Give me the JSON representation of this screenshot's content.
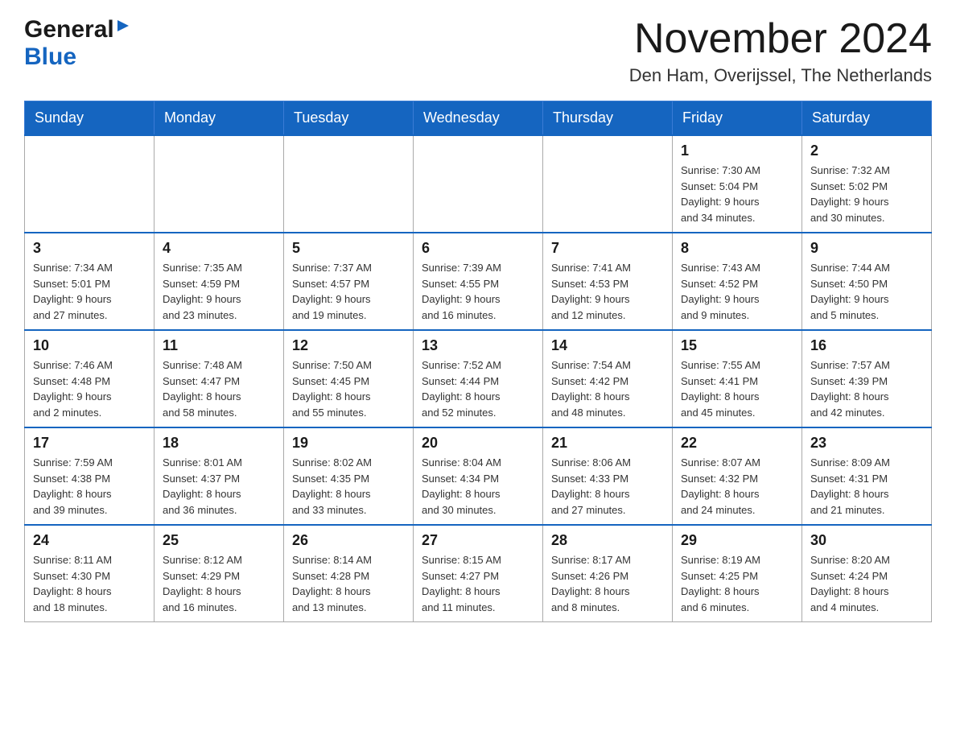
{
  "header": {
    "logo_general": "General",
    "logo_blue": "Blue",
    "title": "November 2024",
    "subtitle": "Den Ham, Overijssel, The Netherlands"
  },
  "days_of_week": [
    "Sunday",
    "Monday",
    "Tuesday",
    "Wednesday",
    "Thursday",
    "Friday",
    "Saturday"
  ],
  "weeks": [
    [
      {
        "day": "",
        "info": ""
      },
      {
        "day": "",
        "info": ""
      },
      {
        "day": "",
        "info": ""
      },
      {
        "day": "",
        "info": ""
      },
      {
        "day": "",
        "info": ""
      },
      {
        "day": "1",
        "info": "Sunrise: 7:30 AM\nSunset: 5:04 PM\nDaylight: 9 hours\nand 34 minutes."
      },
      {
        "day": "2",
        "info": "Sunrise: 7:32 AM\nSunset: 5:02 PM\nDaylight: 9 hours\nand 30 minutes."
      }
    ],
    [
      {
        "day": "3",
        "info": "Sunrise: 7:34 AM\nSunset: 5:01 PM\nDaylight: 9 hours\nand 27 minutes."
      },
      {
        "day": "4",
        "info": "Sunrise: 7:35 AM\nSunset: 4:59 PM\nDaylight: 9 hours\nand 23 minutes."
      },
      {
        "day": "5",
        "info": "Sunrise: 7:37 AM\nSunset: 4:57 PM\nDaylight: 9 hours\nand 19 minutes."
      },
      {
        "day": "6",
        "info": "Sunrise: 7:39 AM\nSunset: 4:55 PM\nDaylight: 9 hours\nand 16 minutes."
      },
      {
        "day": "7",
        "info": "Sunrise: 7:41 AM\nSunset: 4:53 PM\nDaylight: 9 hours\nand 12 minutes."
      },
      {
        "day": "8",
        "info": "Sunrise: 7:43 AM\nSunset: 4:52 PM\nDaylight: 9 hours\nand 9 minutes."
      },
      {
        "day": "9",
        "info": "Sunrise: 7:44 AM\nSunset: 4:50 PM\nDaylight: 9 hours\nand 5 minutes."
      }
    ],
    [
      {
        "day": "10",
        "info": "Sunrise: 7:46 AM\nSunset: 4:48 PM\nDaylight: 9 hours\nand 2 minutes."
      },
      {
        "day": "11",
        "info": "Sunrise: 7:48 AM\nSunset: 4:47 PM\nDaylight: 8 hours\nand 58 minutes."
      },
      {
        "day": "12",
        "info": "Sunrise: 7:50 AM\nSunset: 4:45 PM\nDaylight: 8 hours\nand 55 minutes."
      },
      {
        "day": "13",
        "info": "Sunrise: 7:52 AM\nSunset: 4:44 PM\nDaylight: 8 hours\nand 52 minutes."
      },
      {
        "day": "14",
        "info": "Sunrise: 7:54 AM\nSunset: 4:42 PM\nDaylight: 8 hours\nand 48 minutes."
      },
      {
        "day": "15",
        "info": "Sunrise: 7:55 AM\nSunset: 4:41 PM\nDaylight: 8 hours\nand 45 minutes."
      },
      {
        "day": "16",
        "info": "Sunrise: 7:57 AM\nSunset: 4:39 PM\nDaylight: 8 hours\nand 42 minutes."
      }
    ],
    [
      {
        "day": "17",
        "info": "Sunrise: 7:59 AM\nSunset: 4:38 PM\nDaylight: 8 hours\nand 39 minutes."
      },
      {
        "day": "18",
        "info": "Sunrise: 8:01 AM\nSunset: 4:37 PM\nDaylight: 8 hours\nand 36 minutes."
      },
      {
        "day": "19",
        "info": "Sunrise: 8:02 AM\nSunset: 4:35 PM\nDaylight: 8 hours\nand 33 minutes."
      },
      {
        "day": "20",
        "info": "Sunrise: 8:04 AM\nSunset: 4:34 PM\nDaylight: 8 hours\nand 30 minutes."
      },
      {
        "day": "21",
        "info": "Sunrise: 8:06 AM\nSunset: 4:33 PM\nDaylight: 8 hours\nand 27 minutes."
      },
      {
        "day": "22",
        "info": "Sunrise: 8:07 AM\nSunset: 4:32 PM\nDaylight: 8 hours\nand 24 minutes."
      },
      {
        "day": "23",
        "info": "Sunrise: 8:09 AM\nSunset: 4:31 PM\nDaylight: 8 hours\nand 21 minutes."
      }
    ],
    [
      {
        "day": "24",
        "info": "Sunrise: 8:11 AM\nSunset: 4:30 PM\nDaylight: 8 hours\nand 18 minutes."
      },
      {
        "day": "25",
        "info": "Sunrise: 8:12 AM\nSunset: 4:29 PM\nDaylight: 8 hours\nand 16 minutes."
      },
      {
        "day": "26",
        "info": "Sunrise: 8:14 AM\nSunset: 4:28 PM\nDaylight: 8 hours\nand 13 minutes."
      },
      {
        "day": "27",
        "info": "Sunrise: 8:15 AM\nSunset: 4:27 PM\nDaylight: 8 hours\nand 11 minutes."
      },
      {
        "day": "28",
        "info": "Sunrise: 8:17 AM\nSunset: 4:26 PM\nDaylight: 8 hours\nand 8 minutes."
      },
      {
        "day": "29",
        "info": "Sunrise: 8:19 AM\nSunset: 4:25 PM\nDaylight: 8 hours\nand 6 minutes."
      },
      {
        "day": "30",
        "info": "Sunrise: 8:20 AM\nSunset: 4:24 PM\nDaylight: 8 hours\nand 4 minutes."
      }
    ]
  ]
}
